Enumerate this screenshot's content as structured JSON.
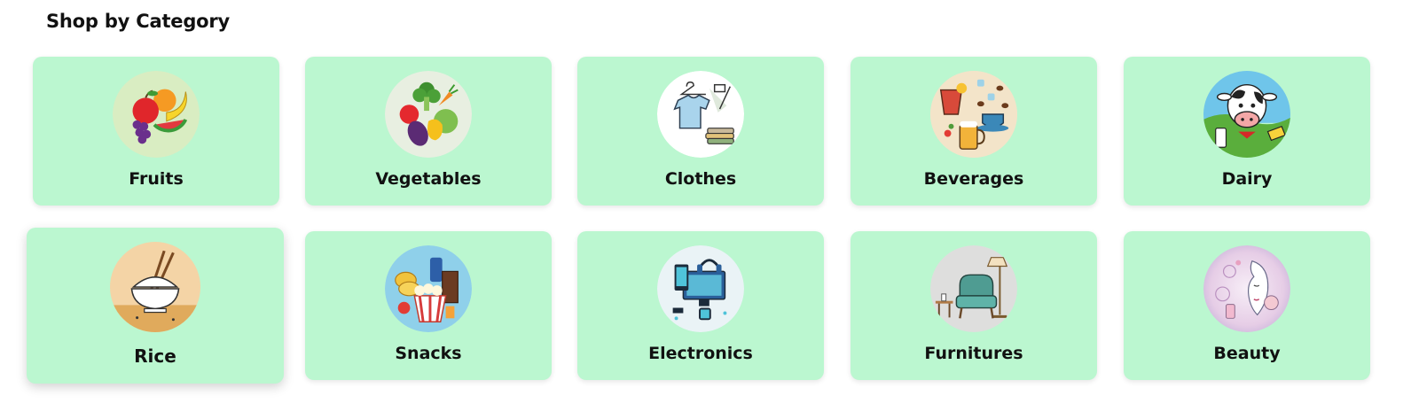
{
  "section": {
    "title": "Shop by Category"
  },
  "categories": [
    {
      "label": "Fruits",
      "icon": "fruits-icon"
    },
    {
      "label": "Vegetables",
      "icon": "vegetables-icon"
    },
    {
      "label": "Clothes",
      "icon": "clothes-icon"
    },
    {
      "label": "Beverages",
      "icon": "beverages-icon"
    },
    {
      "label": "Dairy",
      "icon": "dairy-icon"
    },
    {
      "label": "Rice",
      "icon": "rice-icon"
    },
    {
      "label": "Snacks",
      "icon": "snacks-icon"
    },
    {
      "label": "Electronics",
      "icon": "electronics-icon"
    },
    {
      "label": "Furnitures",
      "icon": "furnitures-icon"
    },
    {
      "label": "Beauty",
      "icon": "beauty-icon"
    }
  ],
  "colors": {
    "card_background": "#bbf7d0",
    "text": "#111111"
  }
}
